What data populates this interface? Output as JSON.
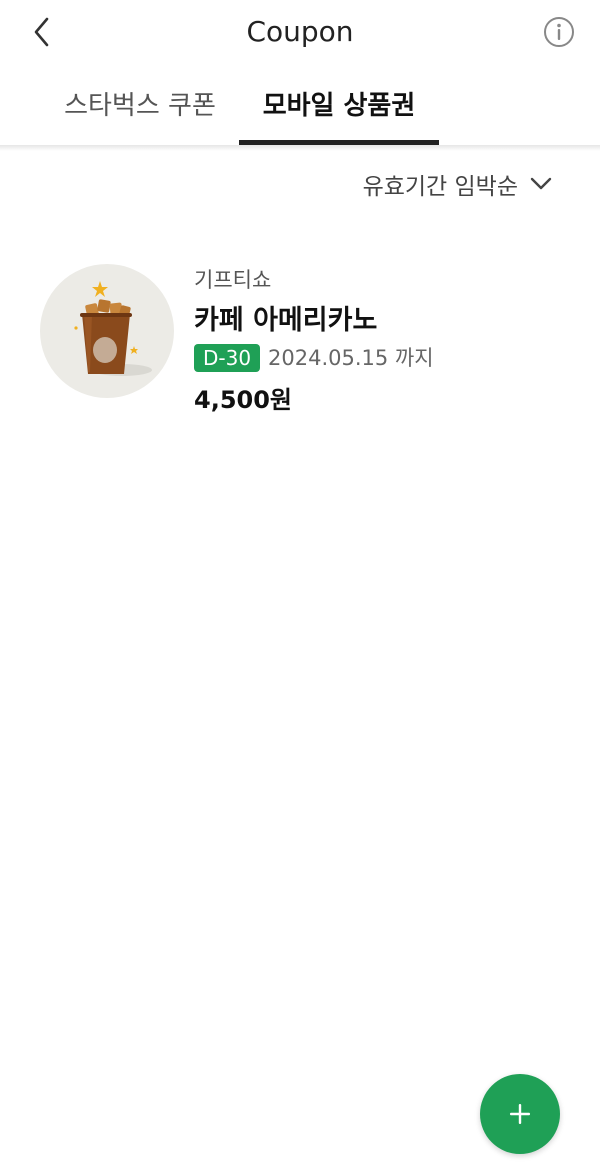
{
  "header": {
    "title": "Coupon",
    "back_icon": "chevron-left-icon",
    "info_icon": "info-circle-icon"
  },
  "tabs": [
    {
      "label": "스타벅스 쿠폰",
      "active": false
    },
    {
      "label": "모바일 상품권",
      "active": true
    }
  ],
  "sort": {
    "label": "유효기간 임박순",
    "icon": "chevron-down-icon"
  },
  "coupons": [
    {
      "brand": "기프티쇼",
      "product": "카페 아메리카노",
      "dday": "D-30",
      "expiry": "2024.05.15 까지",
      "price": "4,500원",
      "image": "iced-coffee-cup-image"
    }
  ],
  "fab": {
    "icon": "plus-icon"
  },
  "colors": {
    "accent": "#1fa056",
    "text_primary": "#111111",
    "text_secondary": "#666666",
    "thumbnail_bg": "#ecebe6"
  }
}
